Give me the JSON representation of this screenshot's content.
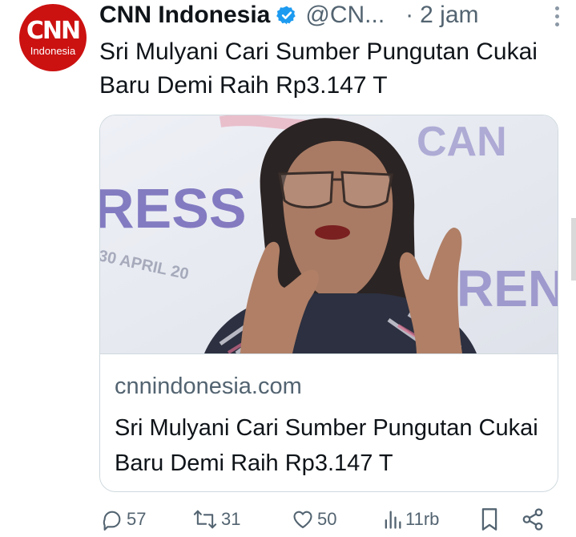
{
  "tweet": {
    "author_name": "CNN Indonesia",
    "handle": "@CN...",
    "separator": "·",
    "time": "2 jam",
    "text": "Sri Mulyani Cari Sumber Pungutan Cukai Baru Demi Raih Rp3.147 T"
  },
  "avatar": {
    "logo_main": "CNN",
    "logo_sub": "Indonesia"
  },
  "card": {
    "image_backdrop_text_1": "RESS",
    "image_backdrop_text_2": "REN",
    "image_backdrop_text_3": "CAN",
    "image_backdrop_date": "30 APRIL 20",
    "domain": "cnnindonesia.com",
    "title": "Sri Mulyani Cari Sumber Pungutan Cukai Baru Demi Raih Rp3.147 T"
  },
  "actions": {
    "replies": "57",
    "reposts": "31",
    "likes": "50",
    "views": "11rb"
  },
  "colors": {
    "brand_red": "#cc1111",
    "verified_blue": "#1d9bf0",
    "muted": "#536471"
  },
  "icons": [
    "verified-badge-icon",
    "more-icon",
    "reply-icon",
    "repost-icon",
    "like-icon",
    "views-icon",
    "bookmark-icon",
    "share-icon"
  ]
}
